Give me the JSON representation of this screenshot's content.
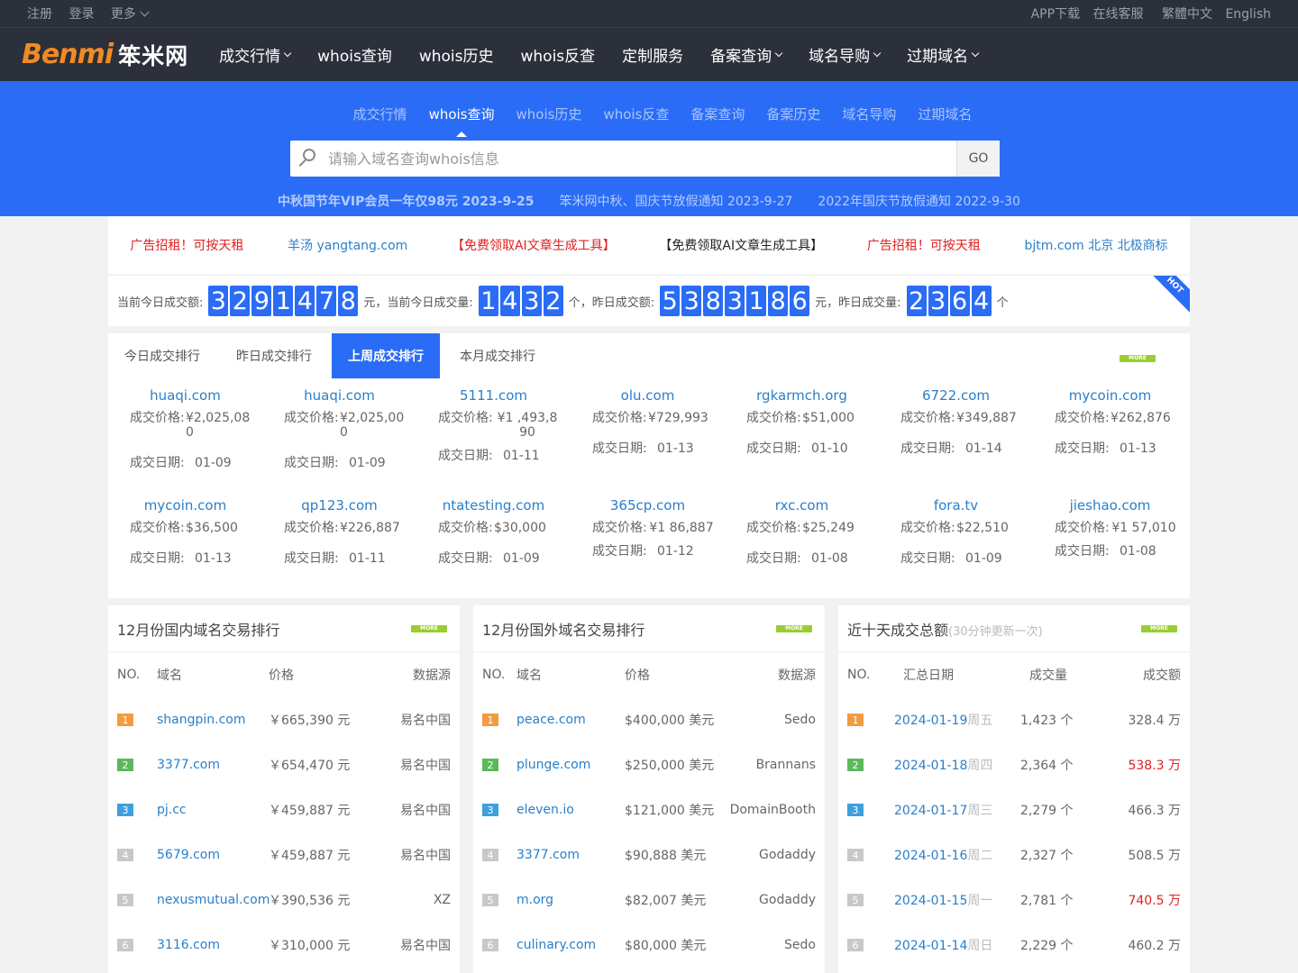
{
  "topbar": {
    "left": [
      "注册",
      "登录"
    ],
    "more": "更多",
    "right": [
      "APP下载",
      "在线客服",
      "繁體中文",
      "English"
    ]
  },
  "nav": {
    "logo_en": "Benmi",
    "logo_cn": "笨米网",
    "items": [
      {
        "label": "成交行情",
        "dropdown": true
      },
      {
        "label": "whois查询",
        "dropdown": false
      },
      {
        "label": "whois历史",
        "dropdown": false
      },
      {
        "label": "whois反查",
        "dropdown": false
      },
      {
        "label": "定制服务",
        "dropdown": false
      },
      {
        "label": "备案查询",
        "dropdown": true
      },
      {
        "label": "域名导购",
        "dropdown": true
      },
      {
        "label": "过期域名",
        "dropdown": true
      }
    ]
  },
  "hero": {
    "tabs": [
      "成交行情",
      "whois查询",
      "whois历史",
      "whois反查",
      "备案查询",
      "备案历史",
      "域名导购",
      "过期域名"
    ],
    "active_tab": 1,
    "search_placeholder": "请输入域名查询whois信息",
    "go_label": "GO",
    "notices": [
      "中秋国节年VIP会员一年仅98元 2023-9-25",
      "笨米网中秋、国庆节放假通知 2023-9-27",
      "2022年国庆节放假通知 2022-9-30"
    ]
  },
  "ads": [
    {
      "text": "广告招租！可按天租",
      "color": "#e02020"
    },
    {
      "text": "羊汤 yangtang.com",
      "color": "#2a7fc8"
    },
    {
      "text": "【免费领取AI文章生成工具】",
      "color": "#e02020"
    },
    {
      "text": "【免费领取AI文章生成工具】",
      "color": "#222222"
    },
    {
      "text": "广告招租！可按天租",
      "color": "#e02020"
    },
    {
      "text": "bjtm.com 北京 北极商标",
      "color": "#2a7fc8"
    }
  ],
  "stats": {
    "today_amount_label": "当前今日成交额:",
    "today_amount": "3291478",
    "unit_yuan_1": "元，当前今日成交量:",
    "today_count": "1432",
    "unit_ge_1": "个，昨日成交额:",
    "yesterday_amount": "5383186",
    "unit_yuan_2": "元，昨日成交量:",
    "yesterday_count": "2364",
    "unit_ge_2": "个",
    "hot_badge": "HOT"
  },
  "ranking": {
    "tabs": [
      "今日成交排行",
      "昨日成交排行",
      "上周成交排行",
      "本月成交排行"
    ],
    "active_tab": 2,
    "more": "MORE",
    "price_label": "成交价格:",
    "date_label": "成交日期:",
    "items": [
      {
        "domain": "huaqi.com",
        "price": "¥2,025,080",
        "date": "01-09"
      },
      {
        "domain": "huaqi.com",
        "price": "¥2,025,000",
        "date": "01-09"
      },
      {
        "domain": "5111.com",
        "price": "¥1 ,493,890",
        "date": "01-11",
        "wrap": true
      },
      {
        "domain": "olu.com",
        "price": "¥729,993",
        "date": "01-13"
      },
      {
        "domain": "rgkarmch.org",
        "price": "$51,000",
        "date": "01-10"
      },
      {
        "domain": "6722.com",
        "price": "¥349,887",
        "date": "01-14"
      },
      {
        "domain": "mycoin.com",
        "price": "¥262,876",
        "date": "01-13"
      },
      {
        "domain": "mycoin.com",
        "price": "$36,500",
        "date": "01-13"
      },
      {
        "domain": "qp123.com",
        "price": "¥226,887",
        "date": "01-11"
      },
      {
        "domain": "ntatesting.com",
        "price": "$30,000",
        "date": "01-09"
      },
      {
        "domain": "365cp.com",
        "price": "¥1 86,887",
        "date": "01-12",
        "wrap": true
      },
      {
        "domain": "rxc.com",
        "price": "$25,249",
        "date": "01-08"
      },
      {
        "domain": "fora.tv",
        "price": "$22,510",
        "date": "01-09"
      },
      {
        "domain": "jieshao.com",
        "price": "¥1 57,010",
        "date": "01-08",
        "wrap": true
      }
    ]
  },
  "domestic": {
    "title": "12月份国内域名交易排行",
    "more": "MORE",
    "headers": [
      "NO.",
      "域名",
      "价格",
      "数据源"
    ],
    "rows": [
      {
        "no": "1",
        "domain": "shangpin.com",
        "price": "￥665,390 元",
        "source": "易名中国"
      },
      {
        "no": "2",
        "domain": "3377.com",
        "price": "￥654,470 元",
        "source": "易名中国"
      },
      {
        "no": "3",
        "domain": "pj.cc",
        "price": "￥459,887 元",
        "source": "易名中国"
      },
      {
        "no": "4",
        "domain": "5679.com",
        "price": "￥459,887 元",
        "source": "易名中国"
      },
      {
        "no": "5",
        "domain": "nexusmutual.com",
        "price": "￥390,536 元",
        "source": "XZ"
      },
      {
        "no": "6",
        "domain": "3116.com",
        "price": "￥310,000 元",
        "source": "易名中国"
      }
    ]
  },
  "foreign": {
    "title": "12月份国外域名交易排行",
    "more": "MORE",
    "headers": [
      "NO.",
      "域名",
      "价格",
      "数据源"
    ],
    "rows": [
      {
        "no": "1",
        "domain": "peace.com",
        "price": "$400,000 美元",
        "source": "Sedo"
      },
      {
        "no": "2",
        "domain": "plunge.com",
        "price": "$250,000 美元",
        "source": "Brannans"
      },
      {
        "no": "3",
        "domain": "eleven.io",
        "price": "$121,000 美元",
        "source": "DomainBooth"
      },
      {
        "no": "4",
        "domain": "3377.com",
        "price": "$90,888 美元",
        "source": "Godaddy"
      },
      {
        "no": "5",
        "domain": "m.org",
        "price": "$82,007 美元",
        "source": "Godaddy"
      },
      {
        "no": "6",
        "domain": "culinary.com",
        "price": "$80,000 美元",
        "source": "Sedo"
      }
    ]
  },
  "tenday": {
    "title": "近十天成交总额",
    "subtitle": "(30分钟更新一次)",
    "more": "MORE",
    "headers": [
      "NO.",
      "汇总日期",
      "成交量",
      "成交额"
    ],
    "rows": [
      {
        "no": "1",
        "date": "2024-01-19",
        "weekday": "周五",
        "count": "1,423 个",
        "amount": "328.4 万",
        "highlight": false
      },
      {
        "no": "2",
        "date": "2024-01-18",
        "weekday": "周四",
        "count": "2,364 个",
        "amount": "538.3 万",
        "highlight": true
      },
      {
        "no": "3",
        "date": "2024-01-17",
        "weekday": "周三",
        "count": "2,279 个",
        "amount": "466.3 万",
        "highlight": false
      },
      {
        "no": "4",
        "date": "2024-01-16",
        "weekday": "周二",
        "count": "2,327 个",
        "amount": "508.5 万",
        "highlight": false
      },
      {
        "no": "5",
        "date": "2024-01-15",
        "weekday": "周一",
        "count": "2,781 个",
        "amount": "740.5 万",
        "highlight": true
      },
      {
        "no": "6",
        "date": "2024-01-14",
        "weekday": "周日",
        "count": "2,229 个",
        "amount": "460.2 万",
        "highlight": false
      }
    ]
  }
}
